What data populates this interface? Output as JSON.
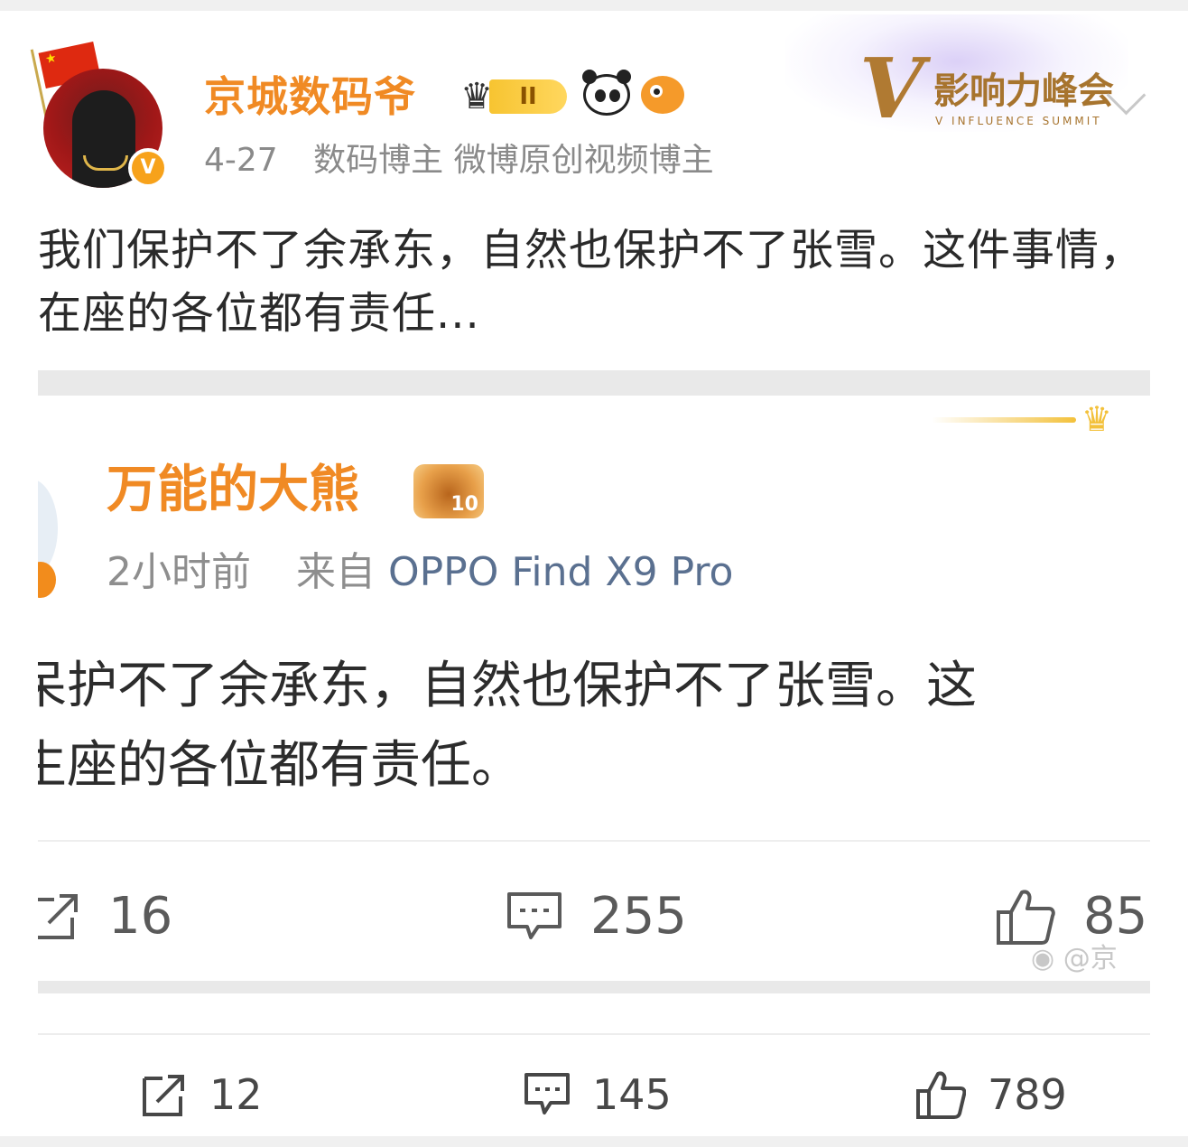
{
  "post": {
    "author": {
      "name": "京城数码爷",
      "level_badge": "II",
      "verified_badge": "V"
    },
    "date": "4-27",
    "tags": "数码博主 微博原创视频博主",
    "event_logo": {
      "cn": "影响力峰会",
      "en": "V INFLUENCE SUMMIT",
      "letter": "V"
    },
    "text": "我们保护不了余承东，自然也保护不了张雪。这件事情，在座的各位都有责任...",
    "actions": {
      "share": "12",
      "comment": "145",
      "like": "789"
    }
  },
  "embedded": {
    "author": {
      "name": "万能的大熊",
      "badge_num": "10"
    },
    "time": "2小时前",
    "source_prefix": "来自",
    "source": "OPPO Find X9 Pro",
    "line1": "呆护不了余承东，自然也保护不了张雪。这",
    "line2": "生座的各位都有责任。",
    "actions": {
      "share": "16",
      "comment": "255",
      "like": "85"
    },
    "watermark": "@京"
  },
  "icons": {
    "share": "share-icon",
    "comment": "comment-icon",
    "like": "thumbs-up-icon",
    "more": "chevron-down-icon"
  },
  "colors": {
    "accent": "#f08a24",
    "text": "#2a2a2a",
    "muted": "#8a8a8a",
    "gold": "#b07a32"
  }
}
